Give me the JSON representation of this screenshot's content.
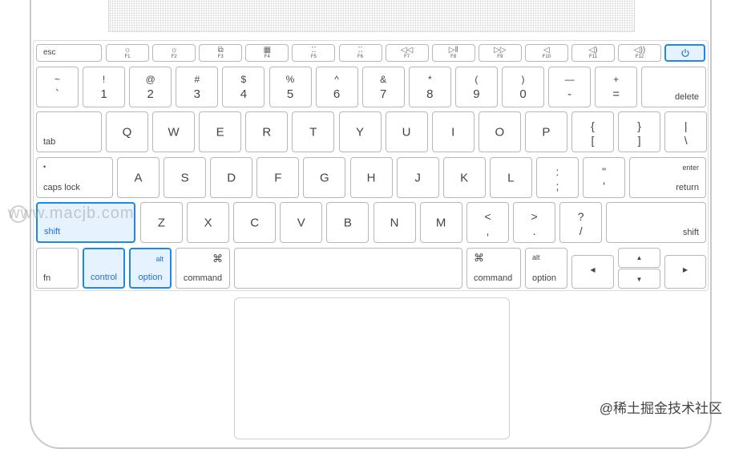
{
  "keyboard": {
    "function_row": {
      "esc": "esc",
      "keys": [
        {
          "icon": "☼",
          "label": "F1"
        },
        {
          "icon": "☼",
          "label": "F2"
        },
        {
          "icon": "⧉",
          "label": "F3"
        },
        {
          "icon": "▦",
          "label": "F4"
        },
        {
          "icon": "⁚⁚",
          "label": "F5"
        },
        {
          "icon": "⁚⁚",
          "label": "F6"
        },
        {
          "icon": "◁◁",
          "label": "F7"
        },
        {
          "icon": "▷‖",
          "label": "F8"
        },
        {
          "icon": "▷▷",
          "label": "F9"
        },
        {
          "icon": "◁",
          "label": "F10"
        },
        {
          "icon": "◁)",
          "label": "F11"
        },
        {
          "icon": "◁))",
          "label": "F12"
        }
      ],
      "power_icon": "power-icon"
    },
    "number_row": [
      {
        "top": "~",
        "bottom": "`"
      },
      {
        "top": "!",
        "bottom": "1"
      },
      {
        "top": "@",
        "bottom": "2"
      },
      {
        "top": "#",
        "bottom": "3"
      },
      {
        "top": "$",
        "bottom": "4"
      },
      {
        "top": "%",
        "bottom": "5"
      },
      {
        "top": "^",
        "bottom": "6"
      },
      {
        "top": "&",
        "bottom": "7"
      },
      {
        "top": "*",
        "bottom": "8"
      },
      {
        "top": "(",
        "bottom": "9"
      },
      {
        "top": ")",
        "bottom": "0"
      },
      {
        "top": "—",
        "bottom": "-"
      },
      {
        "top": "+",
        "bottom": "="
      }
    ],
    "delete": "delete",
    "tab": "tab",
    "qwerty_row": [
      "Q",
      "W",
      "E",
      "R",
      "T",
      "Y",
      "U",
      "I",
      "O",
      "P"
    ],
    "bracket_keys": [
      {
        "top": "{",
        "bottom": "["
      },
      {
        "top": "}",
        "bottom": "]"
      },
      {
        "top": "|",
        "bottom": "\\"
      }
    ],
    "caps_lock": "caps lock",
    "home_row": [
      "A",
      "S",
      "D",
      "F",
      "G",
      "H",
      "J",
      "K",
      "L"
    ],
    "punct_home": [
      {
        "top": ":",
        "bottom": ";"
      },
      {
        "top": "\"",
        "bottom": "'"
      }
    ],
    "enter_top": "enter",
    "return_label": "return",
    "shift_left": "shift",
    "bottom_letters": [
      "Z",
      "X",
      "C",
      "V",
      "B",
      "N",
      "M"
    ],
    "punct_bottom": [
      {
        "top": "<",
        "bottom": ","
      },
      {
        "top": ">",
        "bottom": "."
      },
      {
        "top": "?",
        "bottom": "/"
      }
    ],
    "shift_right": "shift",
    "fn": "fn",
    "control": "control",
    "alt": "alt",
    "option": "option",
    "command_symbol": "⌘",
    "command": "command",
    "arrow_left": "◀",
    "arrow_up": "▲",
    "arrow_down": "▼",
    "arrow_right": "▶",
    "highlighted_keys": [
      "shift-left",
      "control",
      "option-left"
    ],
    "highlight_color": "#1e88e5"
  },
  "watermark": "www.macjb.com",
  "credit": "@稀土掘金技术社区"
}
